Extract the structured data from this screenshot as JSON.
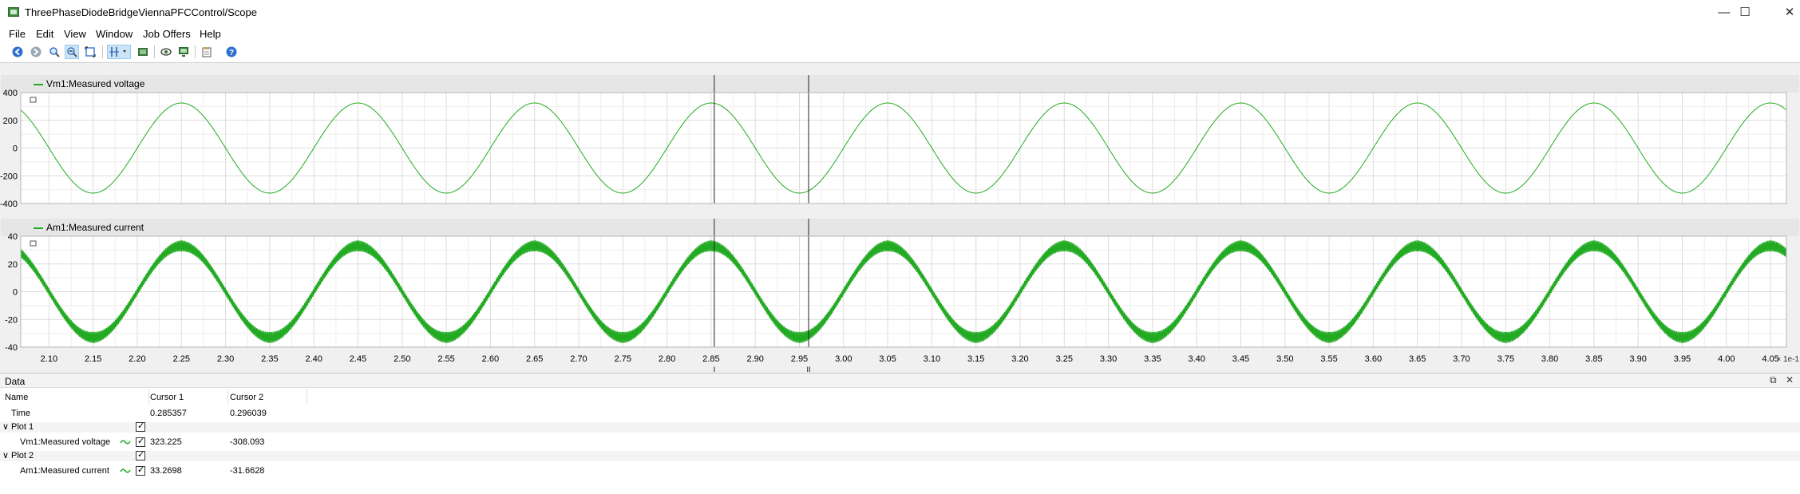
{
  "window": {
    "title": "ThreePhaseDiodeBridgeViennaPFCControl/Scope",
    "minimize": "—",
    "maximize": "☐",
    "close": "✕"
  },
  "menu": [
    "File",
    "Edit",
    "View",
    "Window",
    "Job Offers",
    "Help"
  ],
  "toolbar_icons": [
    "back-icon",
    "forward-icon",
    "zoom-icon",
    "zoom-out-icon",
    "zoom-fit-icon",
    "cursor-icon",
    "dropdown-icon",
    "screenshot-icon",
    "visibility-icon",
    "display-icon",
    "clipboard-icon",
    "help-icon"
  ],
  "plots": [
    {
      "legend": "Vm1:Measured voltage",
      "color": "#22aa22",
      "y_ticks": [
        "400",
        "200",
        "0",
        "-200",
        "-400"
      ]
    },
    {
      "legend": "Am1:Measured current",
      "color": "#22aa22",
      "y_ticks": [
        "40",
        "20",
        "0",
        "-20",
        "-40"
      ]
    }
  ],
  "x_axis": {
    "ticks": [
      "2.10",
      "2.15",
      "2.20",
      "2.25",
      "2.30",
      "2.35",
      "2.40",
      "2.45",
      "2.50",
      "2.55",
      "2.60",
      "2.65",
      "2.70",
      "2.75",
      "2.80",
      "2.85",
      "2.90",
      "2.95",
      "3.00",
      "3.05",
      "3.10",
      "3.15",
      "3.20",
      "3.25",
      "3.30",
      "3.35",
      "3.40",
      "3.45",
      "3.50",
      "3.55",
      "3.60",
      "3.65",
      "3.70",
      "3.75",
      "3.80",
      "3.85",
      "3.90",
      "3.95",
      "4.00",
      "4.05"
    ],
    "multiplier": "× 1e-1"
  },
  "cursors": {
    "c1_label": "I",
    "c2_label": "II"
  },
  "chart_data": [
    {
      "type": "line",
      "title": "",
      "series": [
        {
          "name": "Vm1:Measured voltage",
          "shape": "sine",
          "amplitude": 325,
          "period": 0.2,
          "peak_at": 2.25
        }
      ],
      "xlim": [
        2.068,
        4.068
      ],
      "ylim": [
        -400,
        400
      ],
      "x_scale": "× 1e-1",
      "grid": true
    },
    {
      "type": "line",
      "title": "",
      "series": [
        {
          "name": "Am1:Measured current",
          "shape": "sine with switching ripple",
          "amplitude": 33,
          "ripple": 4,
          "period": 0.2,
          "peak_at": 2.25
        }
      ],
      "xlim": [
        2.068,
        4.068
      ],
      "ylim": [
        -40,
        40
      ],
      "x_scale": "× 1e-1",
      "grid": true
    }
  ],
  "cursor_values": {
    "cursor1": 2.85357,
    "cursor2": 2.96039
  },
  "data_panel": {
    "title": "Data",
    "columns": [
      "Name",
      "Cursor 1",
      "Cursor 2"
    ],
    "time_row": {
      "name": "Time",
      "c1": "0.285357",
      "c2": "0.296039"
    },
    "groups": [
      {
        "name": "Plot 1",
        "signal": "Vm1:Measured voltage",
        "c1": "323.225",
        "c2": "-308.093"
      },
      {
        "name": "Plot 2",
        "signal": "Am1:Measured current",
        "c1": "33.2698",
        "c2": "-31.6628"
      }
    ],
    "restore_icon": "⧉",
    "close_icon": "✕",
    "expand_icon": "∨"
  }
}
